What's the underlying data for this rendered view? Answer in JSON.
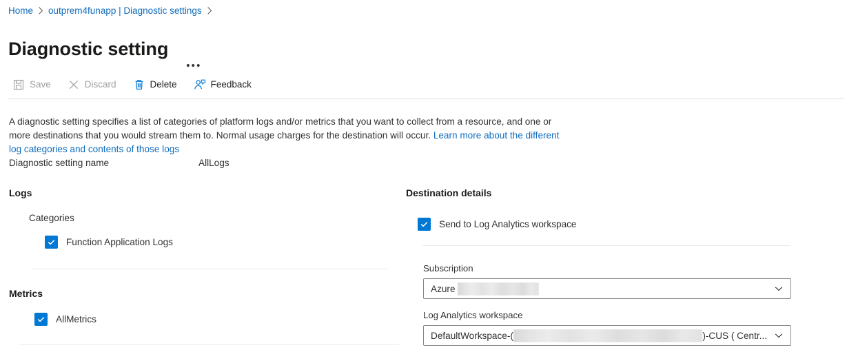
{
  "breadcrumb": {
    "items": [
      {
        "label": "Home",
        "name": "breadcrumb-home"
      },
      {
        "label": "outprem4funapp | Diagnostic settings",
        "name": "breadcrumb-resource"
      }
    ]
  },
  "header": {
    "title": "Diagnostic setting",
    "more_menu": "•••"
  },
  "toolbar": {
    "save_label": "Save",
    "discard_label": "Discard",
    "delete_label": "Delete",
    "feedback_label": "Feedback"
  },
  "description": {
    "text_before": "A diagnostic setting specifies a list of categories of platform logs and/or metrics that you want to collect from a resource, and one or more destinations that you would stream them to. Normal usage charges for the destination will occur. ",
    "link_text": "Learn more about the different log categories and contents of those logs"
  },
  "setting_name": {
    "label": "Diagnostic setting name",
    "value": "AllLogs"
  },
  "logs": {
    "heading": "Logs",
    "categories_label": "Categories",
    "items": [
      {
        "label": "Function Application Logs",
        "checked": true
      }
    ]
  },
  "metrics": {
    "heading": "Metrics",
    "items": [
      {
        "label": "AllMetrics",
        "checked": true
      }
    ]
  },
  "destination": {
    "heading": "Destination details",
    "send_to_law_label": "Send to Log Analytics workspace",
    "subscription": {
      "label": "Subscription",
      "value_prefix": "Azure",
      "value_suffix": ""
    },
    "workspace": {
      "label": "Log Analytics workspace",
      "value_prefix": "DefaultWorkspace-(",
      "value_suffix": ")-CUS ( Centr..."
    }
  },
  "colors": {
    "accent": "#0078d4",
    "link": "#0f6cbd",
    "text": "#323130",
    "disabled": "#a19f9d",
    "divider": "#edebe9"
  }
}
